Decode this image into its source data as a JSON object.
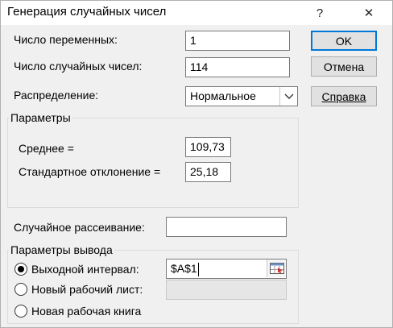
{
  "window": {
    "title": "Генерация случайных чисел",
    "help_glyph": "?",
    "close_glyph": "✕"
  },
  "fields": {
    "num_variables": {
      "label": "Число переменных:",
      "value": "1"
    },
    "num_random": {
      "label": "Число случайных чисел:",
      "value": "114"
    },
    "distribution": {
      "label": "Распределение:",
      "value": "Нормальное"
    }
  },
  "buttons": {
    "ok": "OK",
    "cancel": "Отмена",
    "help": "Справка"
  },
  "parameters": {
    "title": "Параметры",
    "mean": {
      "label": "Среднее =",
      "value": "109,73"
    },
    "stddev": {
      "label": "Стандартное отклонение =",
      "value": "25,18"
    }
  },
  "random_seed": {
    "label": "Случайное рассеивание:",
    "value": ""
  },
  "output": {
    "title": "Параметры вывода",
    "output_range": {
      "label": "Выходной интервал:",
      "value": "$A$1",
      "selected": true
    },
    "new_sheet": {
      "label": "Новый рабочий лист:",
      "value": "",
      "selected": false
    },
    "new_workbook": {
      "label": "Новая рабочая книга",
      "selected": false
    }
  },
  "icons": {
    "help": "help-icon",
    "close": "close-icon",
    "dropdown": "chevron-down-icon",
    "range_picker": "range-select-icon"
  },
  "colors": {
    "dialog_bg": "#f0f0f0",
    "default_button_border": "#0078d7"
  }
}
